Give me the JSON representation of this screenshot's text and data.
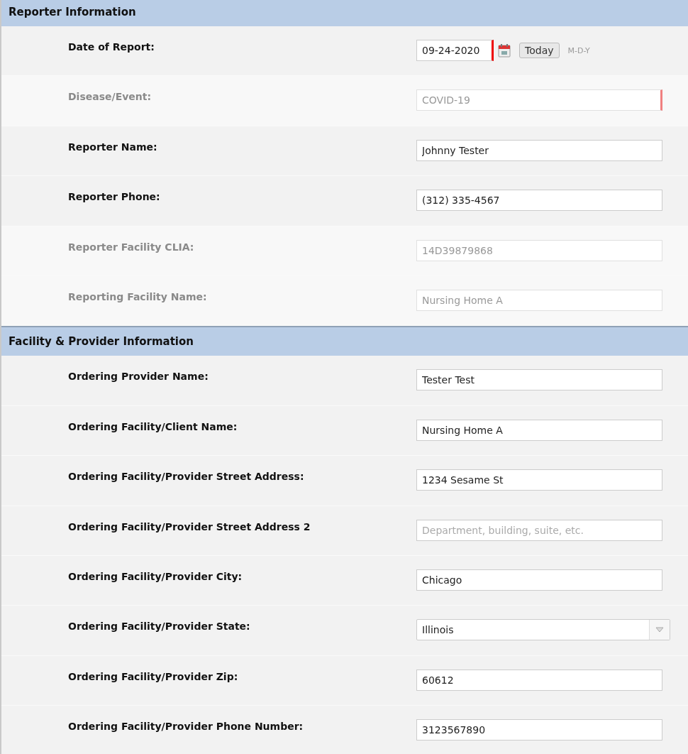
{
  "sections": [
    {
      "title": "Reporter Information",
      "rows": [
        {
          "label": "Date of Report:",
          "kind": "date",
          "value": "09-24-2020",
          "required": true,
          "disabled": false,
          "button": "Today",
          "hint": "M-D-Y"
        },
        {
          "label": "Disease/Event:",
          "kind": "text",
          "value": "COVID-19",
          "required": true,
          "disabled": true
        },
        {
          "label": "Reporter Name:",
          "kind": "text",
          "value": "Johnny Tester",
          "required": false,
          "disabled": false
        },
        {
          "label": "Reporter Phone:",
          "kind": "text",
          "value": "(312) 335-4567",
          "required": false,
          "disabled": false
        },
        {
          "label": "Reporter Facility CLIA:",
          "kind": "text",
          "value": "14D39879868",
          "required": false,
          "disabled": true
        },
        {
          "label": "Reporting Facility Name:",
          "kind": "text",
          "value": "Nursing Home A",
          "required": false,
          "disabled": true
        }
      ]
    },
    {
      "title": "Facility & Provider Information",
      "rows": [
        {
          "label": "Ordering Provider Name:",
          "kind": "text",
          "value": "Tester Test",
          "required": false,
          "disabled": false
        },
        {
          "label": "Ordering Facility/Client Name:",
          "kind": "text",
          "value": "Nursing Home A",
          "required": false,
          "disabled": false
        },
        {
          "label": "Ordering Facility/Provider Street Address:",
          "kind": "text",
          "value": "1234 Sesame St",
          "required": false,
          "disabled": false
        },
        {
          "label": "Ordering Facility/Provider Street Address 2",
          "kind": "text",
          "placeholder": "Department, building, suite, etc.",
          "required": false,
          "disabled": false
        },
        {
          "label": "Ordering Facility/Provider City:",
          "kind": "text",
          "value": "Chicago",
          "required": false,
          "disabled": false
        },
        {
          "label": "Ordering Facility/Provider State:",
          "kind": "select",
          "value": "Illinois",
          "required": false,
          "disabled": false
        },
        {
          "label": "Ordering Facility/Provider Zip:",
          "kind": "text",
          "value": "60612",
          "required": false,
          "disabled": false
        },
        {
          "label": "Ordering Facility/Provider Phone Number:",
          "kind": "text",
          "value": "3123567890",
          "required": false,
          "disabled": false
        }
      ]
    }
  ]
}
